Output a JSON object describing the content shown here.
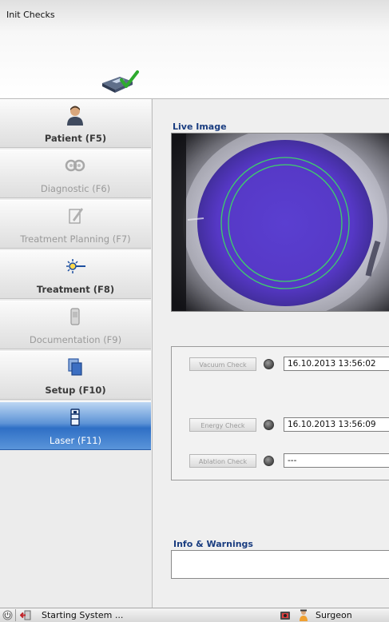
{
  "header": {
    "title": "Init Checks"
  },
  "sidebar": {
    "items": [
      {
        "label": "Patient (F5)"
      },
      {
        "label": "Diagnostic (F6)"
      },
      {
        "label": "Treatment Planning (F7)"
      },
      {
        "label": "Treatment (F8)"
      },
      {
        "label": "Documentation (F9)"
      },
      {
        "label": "Setup (F10)"
      },
      {
        "label": "Laser (F11)"
      }
    ]
  },
  "live_image": {
    "title": "Live Image"
  },
  "checks": {
    "vacuum": {
      "label": "Vacuum Check",
      "value": "16.10.2013 13:56:02"
    },
    "energy": {
      "label": "Energy Check",
      "value": "16.10.2013 13:56:09"
    },
    "ablation": {
      "label": "Ablation Check",
      "value": "---"
    }
  },
  "info": {
    "title": "Info & Warnings"
  },
  "statusbar": {
    "status": "Starting System ...",
    "user": "Surgeon"
  },
  "colors": {
    "accent": "#2f6fc5",
    "section_title": "#1a3d80",
    "ok_check": "#2eaa2e"
  }
}
